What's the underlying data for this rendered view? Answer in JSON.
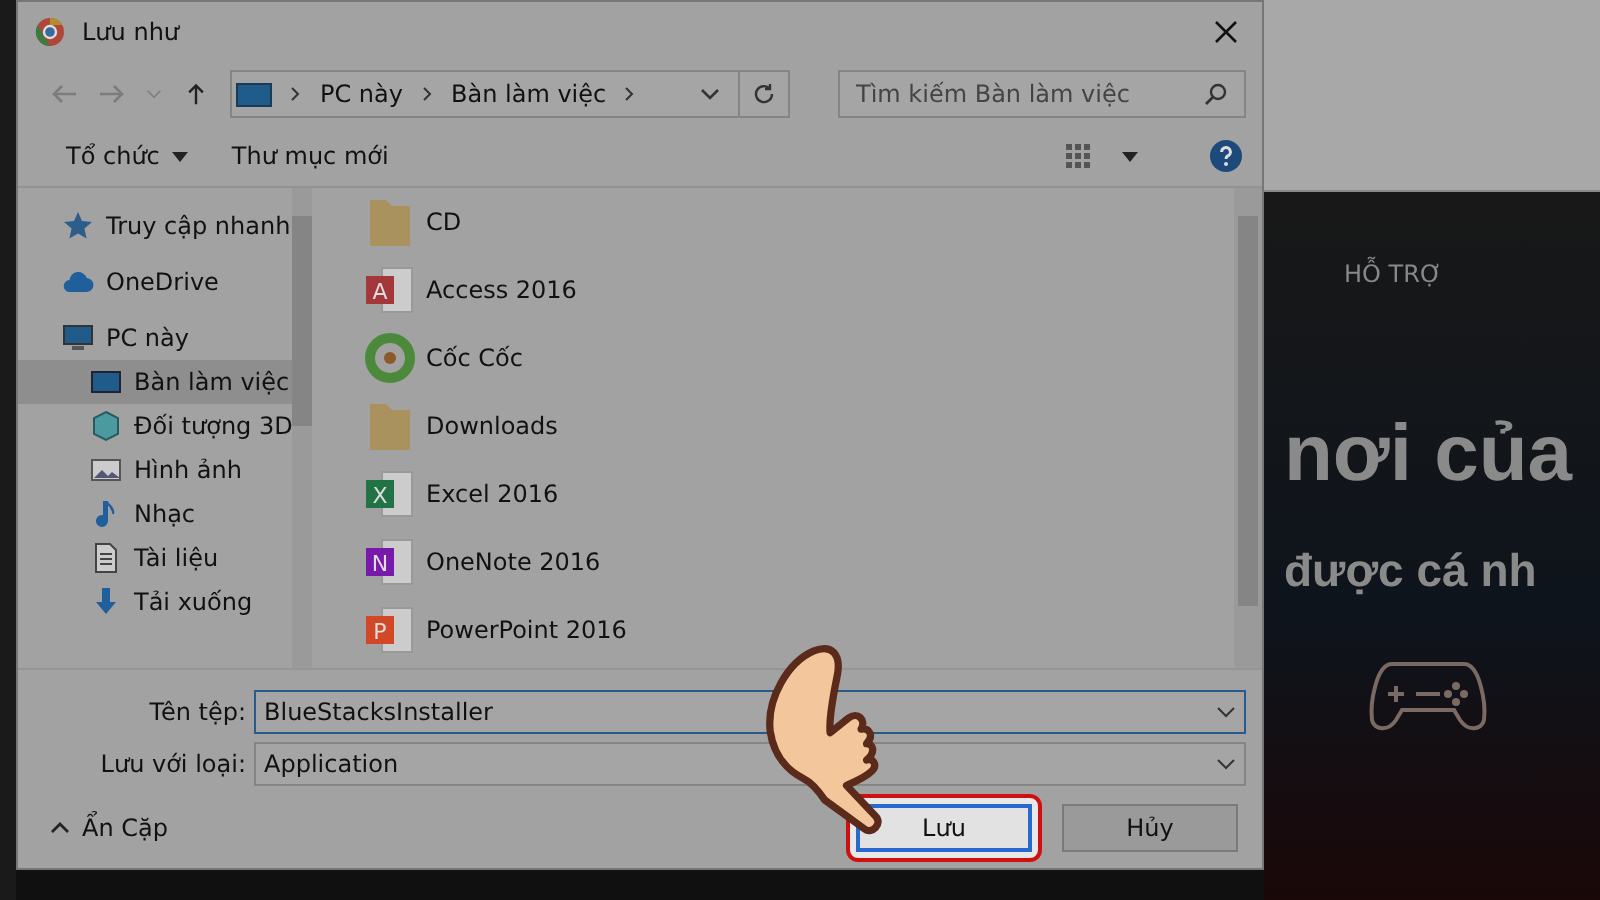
{
  "window": {
    "title": "Lưu như"
  },
  "address_bar": {
    "path": [
      "PC này",
      "Bàn làm việc"
    ]
  },
  "search": {
    "placeholder": "Tìm kiếm Bàn làm việc"
  },
  "toolbar": {
    "organize": "Tổ chức",
    "new_folder": "Thư mục mới"
  },
  "sidebar": {
    "items": [
      {
        "label": "Truy cập nhanh",
        "kind": "star",
        "selected": false
      },
      {
        "label": "OneDrive",
        "kind": "cloud",
        "selected": false
      },
      {
        "label": "PC này",
        "kind": "pc",
        "selected": false,
        "children": [
          {
            "label": "Bàn làm việc",
            "kind": "desktop",
            "selected": true
          },
          {
            "label": "Đối tượng 3D",
            "kind": "cube",
            "selected": false
          },
          {
            "label": "Hình ảnh",
            "kind": "picture",
            "selected": false
          },
          {
            "label": "Nhạc",
            "kind": "music",
            "selected": false
          },
          {
            "label": "Tài liệu",
            "kind": "document",
            "selected": false
          },
          {
            "label": "Tải xuống",
            "kind": "download",
            "selected": false
          }
        ]
      }
    ]
  },
  "files": [
    {
      "name": "CD",
      "kind": "folder"
    },
    {
      "name": "Access 2016",
      "kind": "access",
      "icon_letter": "A"
    },
    {
      "name": "Cốc Cốc",
      "kind": "coccoc"
    },
    {
      "name": "Downloads",
      "kind": "folder"
    },
    {
      "name": "Excel 2016",
      "kind": "excel",
      "icon_letter": "X"
    },
    {
      "name": "OneNote 2016",
      "kind": "onenote",
      "icon_letter": "N"
    },
    {
      "name": "PowerPoint 2016",
      "kind": "powerpoint",
      "icon_letter": "P"
    }
  ],
  "form": {
    "file_name_label": "Tên tệp:",
    "file_name": "BlueStacksInstaller",
    "type_label": "Lưu với loại:",
    "type": "Application"
  },
  "hide_folders": "Ẩn Cặp",
  "buttons": {
    "save": "Lưu",
    "cancel": "Hủy"
  },
  "background_page": {
    "nav": "HỖ TRỢ",
    "heading": "nơi của",
    "subheading": "được cá nh"
  }
}
